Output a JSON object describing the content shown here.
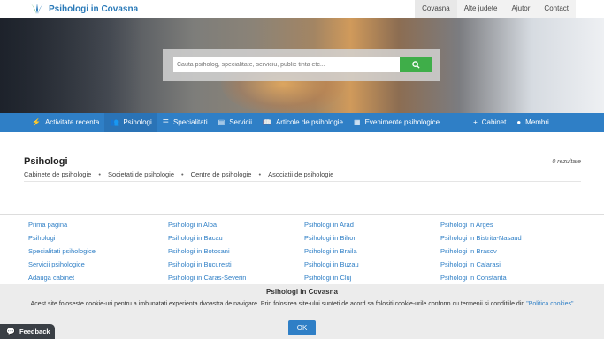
{
  "header": {
    "logo_text": "Psihologi in Covasna",
    "nav": [
      {
        "label": "Covasna"
      },
      {
        "label": "Alte judete"
      },
      {
        "label": "Ajutor"
      },
      {
        "label": "Contact"
      }
    ]
  },
  "search": {
    "placeholder": "Cauta psiholog, specialitate, serviciu, public tinta etc...",
    "button_icon": "search-icon"
  },
  "main_nav": [
    {
      "label": "Activitate recenta",
      "icon": "bolt-icon"
    },
    {
      "label": "Psihologi",
      "icon": "users-icon"
    },
    {
      "label": "Specialitati",
      "icon": "list-icon"
    },
    {
      "label": "Servicii",
      "icon": "server-icon"
    },
    {
      "label": "Articole de psihologie",
      "icon": "book-icon"
    },
    {
      "label": "Evenimente psihologice",
      "icon": "calendar-icon"
    },
    {
      "label": "Cabinet",
      "icon": "plus-icon"
    },
    {
      "label": "Membri",
      "icon": "user-icon"
    }
  ],
  "content": {
    "title": "Psihologi",
    "count": "0 rezultate",
    "subnav": [
      "Cabinete de psihologie",
      "Societati de psihologie",
      "Centre de psihologie",
      "Asociatii de psihologie"
    ]
  },
  "footer": {
    "columns": [
      [
        "Prima pagina",
        "Psihologi",
        "Specialitati psihologice",
        "Servicii psihologice",
        "Adauga cabinet"
      ],
      [
        "Psihologi in Alba",
        "Psihologi in Bacau",
        "Psihologi in Botosani",
        "Psihologi in Bucuresti",
        "Psihologi in Caras-Severin"
      ],
      [
        "Psihologi in Arad",
        "Psihologi in Bihor",
        "Psihologi in Braila",
        "Psihologi in Buzau",
        "Psihologi in Cluj"
      ],
      [
        "Psihologi in Arges",
        "Psihologi in Bistrita-Nasaud",
        "Psihologi in Brasov",
        "Psihologi in Calarasi",
        "Psihologi in Constanta"
      ]
    ]
  },
  "cookie": {
    "title": "Psihologi in Covasna",
    "text": "Acest site foloseste cookie-uri pentru a imbunatati experienta dvoastra de navigare. Prin folosirea site-ului sunteti de acord sa folositi cookie-urile conform cu termenii si conditiile din",
    "policy_link": "\"Politica cookies\"",
    "ok_label": "OK"
  },
  "feedback": {
    "label": "Feedback"
  },
  "colors": {
    "accent": "#2f7fc6",
    "search_button": "#3fae49"
  }
}
